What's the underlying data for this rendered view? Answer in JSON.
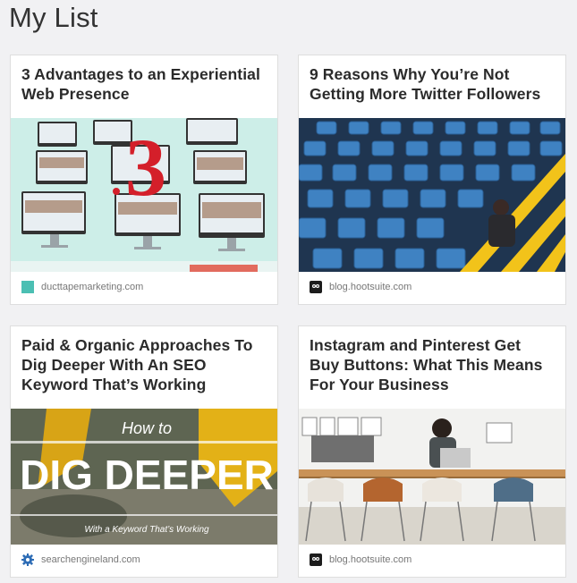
{
  "page": {
    "title": "My List"
  },
  "cards": [
    {
      "title": "3 Advantages to an Experiential Web Presence",
      "source": "ducttapemarketing.com",
      "favicon": "teal-square-icon",
      "image": "devices-showcase"
    },
    {
      "title": "9 Reasons Why You’re Not Getting More Twitter Followers",
      "source": "blog.hootsuite.com",
      "favicon": "owl-icon",
      "image": "stadium-seats"
    },
    {
      "title": "Paid & Organic Approaches To Dig Deeper With An SEO Keyword That’s Working",
      "source": "searchengineland.com",
      "favicon": "gear-icon",
      "image": "excavator",
      "image_text": {
        "script": "How to",
        "headline": "DIG DEEPER",
        "tagline": "With a Keyword That’s Working"
      }
    },
    {
      "title": "Instagram and Pinterest Get Buy Buttons: What This Means For Your Business",
      "source": "blog.hootsuite.com",
      "favicon": "owl-icon",
      "image": "office-table"
    }
  ],
  "colors": {
    "background": "#f1f1f3",
    "card": "#ffffff",
    "title": "#2b2b2b",
    "source": "#777777",
    "teal": "#4bbfb3",
    "blue_seats": "#3f82c2"
  }
}
